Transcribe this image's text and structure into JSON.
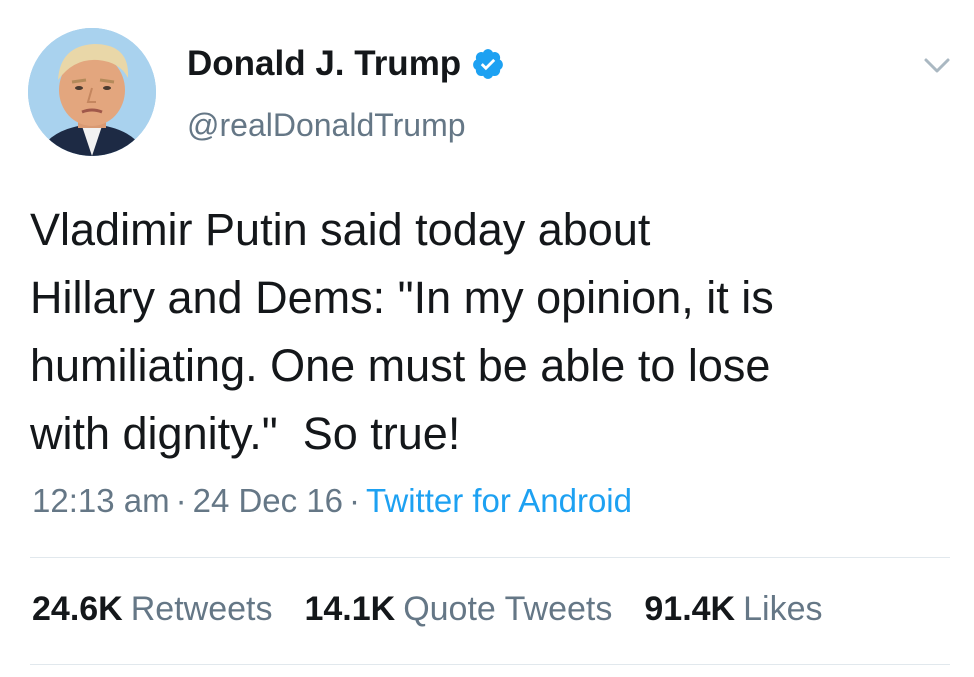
{
  "author": {
    "name": "Donald J. Trump",
    "handle": "@realDonaldTrump",
    "verified": true,
    "avatar_icon": "profile-photo"
  },
  "tweet": {
    "text": "Vladimir Putin said today about\nHillary and Dems: \"In my opinion, it is\nhumiliating. One must be able to lose\nwith dignity.\"  So true!",
    "time": "12:13 am",
    "separator": "·",
    "date": "24 Dec 16",
    "source": "Twitter for Android"
  },
  "stats": [
    {
      "count": "24.6K",
      "label": "Retweets"
    },
    {
      "count": "14.1K",
      "label": "Quote Tweets"
    },
    {
      "count": "91.4K",
      "label": "Likes"
    }
  ],
  "colors": {
    "text": "#14171a",
    "secondary": "#657786",
    "accent": "#1da1f2",
    "divider": "#e1e8ed"
  },
  "icons": {
    "verified": "verified-badge-icon",
    "menu": "chevron-down-icon"
  }
}
